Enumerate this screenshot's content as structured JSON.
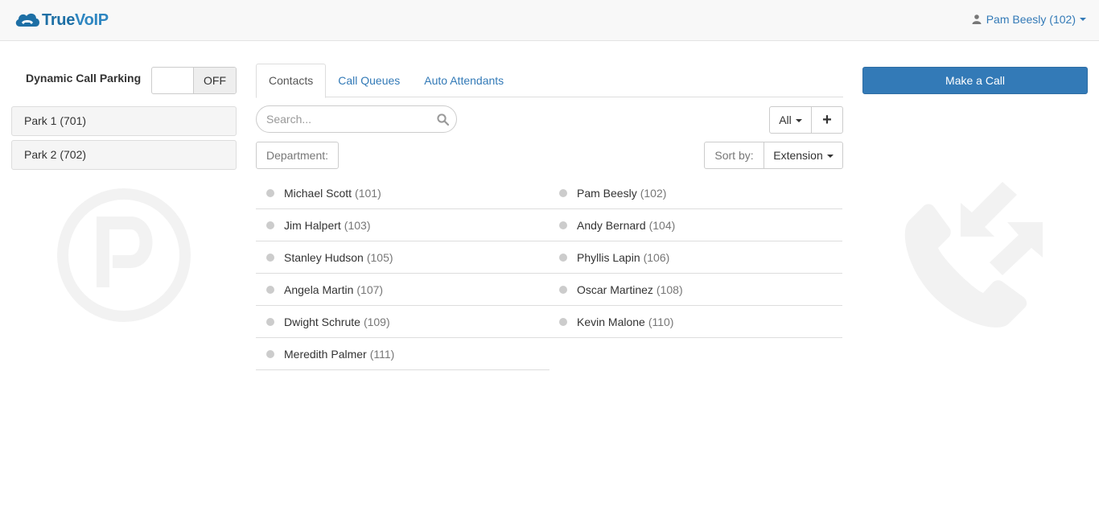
{
  "brand": {
    "name_part1": "True",
    "name_part2": "VoIP"
  },
  "user": {
    "label": "Pam Beesly (102)",
    "icon": "user-icon"
  },
  "parking": {
    "label": "Dynamic Call Parking",
    "toggle_state": "OFF",
    "slots": [
      {
        "label": "Park 1 (701)"
      },
      {
        "label": "Park 2 (702)"
      }
    ]
  },
  "tabs": [
    {
      "label": "Contacts",
      "active": true
    },
    {
      "label": "Call Queues",
      "active": false
    },
    {
      "label": "Auto Attendants",
      "active": false
    }
  ],
  "search": {
    "placeholder": "Search...",
    "value": ""
  },
  "filter": {
    "label": "All",
    "add_label": "+"
  },
  "department": {
    "label": "Department:"
  },
  "sort": {
    "label": "Sort by:",
    "value": "Extension"
  },
  "contacts": [
    {
      "name": "Michael Scott",
      "ext": "(101)"
    },
    {
      "name": "Pam Beesly",
      "ext": "(102)"
    },
    {
      "name": "Jim Halpert",
      "ext": "(103)"
    },
    {
      "name": "Andy Bernard",
      "ext": "(104)"
    },
    {
      "name": "Stanley Hudson",
      "ext": "(105)"
    },
    {
      "name": "Phyllis Lapin",
      "ext": "(106)"
    },
    {
      "name": "Angela Martin",
      "ext": "(107)"
    },
    {
      "name": "Oscar Martinez",
      "ext": "(108)"
    },
    {
      "name": "Dwight Schrute",
      "ext": "(109)"
    },
    {
      "name": "Kevin Malone",
      "ext": "(110)"
    },
    {
      "name": "Meredith Palmer",
      "ext": "(111)"
    }
  ],
  "actions": {
    "make_call": "Make a Call"
  },
  "colors": {
    "primary": "#337ab7",
    "status_offline": "#cccccc",
    "watermark": "#f2f2f2"
  }
}
